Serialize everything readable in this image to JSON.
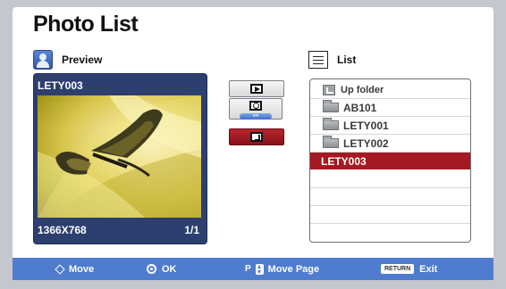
{
  "title": "Photo List",
  "preview": {
    "label": "Preview",
    "icon": "person-icon",
    "name": "LETY003",
    "resolution": "1366X768",
    "page": "1/1"
  },
  "controls": {
    "slideshow_icon": "play-icon",
    "interval_icon": "clock-icon",
    "speed_label": "»»",
    "music_icon": "music-icon",
    "active_color": "#a51a22"
  },
  "list": {
    "label": "List",
    "icon": "list-icon",
    "items": [
      {
        "label": "Up folder",
        "icon": "up-folder-icon"
      },
      {
        "label": "AB101",
        "icon": "folder-icon"
      },
      {
        "label": "LETY001",
        "icon": "folder-icon"
      },
      {
        "label": "LETY002",
        "icon": "folder-icon"
      },
      {
        "label": "LETY003",
        "icon": "",
        "selected": true
      }
    ]
  },
  "footer": {
    "move_label": "Move",
    "ok_label": "OK",
    "page_key": "P",
    "move_page_label": "Move Page",
    "return_key": "RETURN",
    "exit_label": "Exit",
    "bar_color": "#4f7ccf"
  }
}
